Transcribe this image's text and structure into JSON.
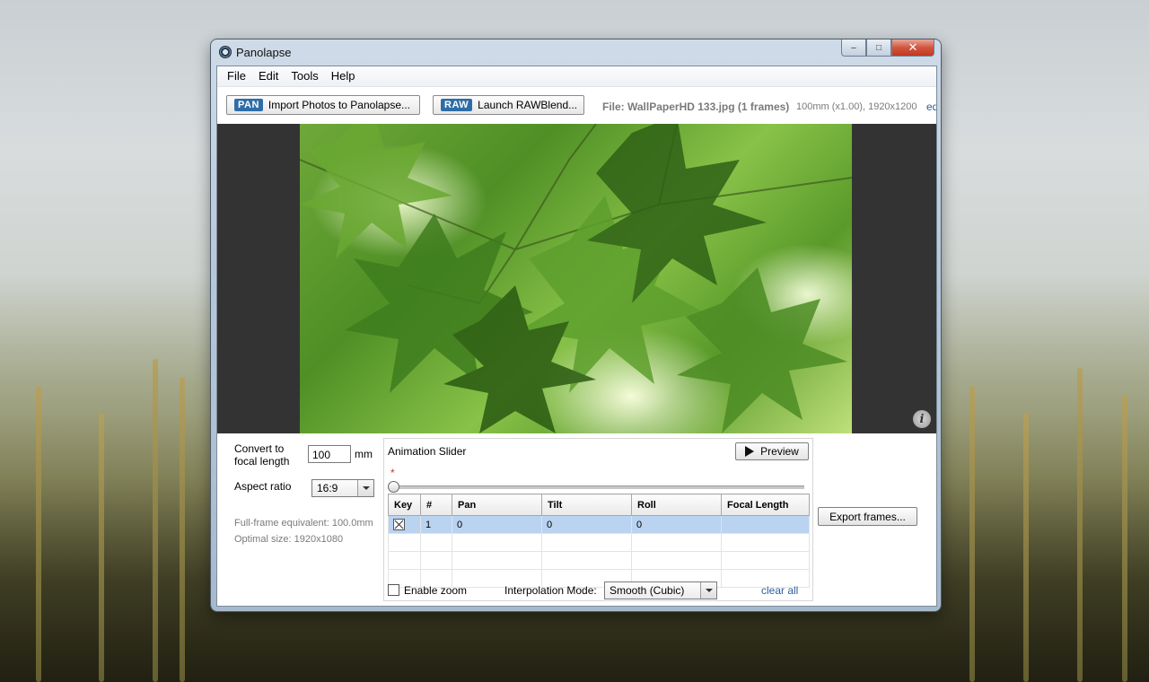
{
  "window": {
    "title": "Panolapse",
    "controls": {
      "minimize": "–",
      "maximize": "□",
      "close": "✕"
    }
  },
  "menu": [
    "File",
    "Edit",
    "Tools",
    "Help"
  ],
  "toolbar": {
    "import_badge": "PAN",
    "import_label": "Import Photos to Panolapse...",
    "raw_badge": "RAW",
    "raw_label": "Launch RAWBlend...",
    "file_info": "File: WallPaperHD 133.jpg (1 frames)",
    "file_details": "100mm (x1.00), 1920x1200",
    "cut_off": "ed"
  },
  "viewer": {
    "info_icon": "i"
  },
  "settings": {
    "convert_label_1": "Convert to",
    "convert_label_2": "focal length",
    "focal_value": "100",
    "focal_unit": "mm",
    "aspect_label": "Aspect ratio",
    "aspect_value": "16:9",
    "fullframe": "Full-frame equivalent: 100.0mm",
    "optimal": "Optimal size: 1920x1080"
  },
  "animation": {
    "title": "Animation Slider",
    "preview_label": "Preview",
    "keyframe_marker": "*",
    "columns": [
      "Key",
      "#",
      "Pan",
      "Tilt",
      "Roll",
      "Focal Length"
    ],
    "rows": [
      {
        "key": true,
        "num": "1",
        "pan": "0",
        "tilt": "0",
        "roll": "0",
        "focal": ""
      }
    ],
    "enable_zoom_label": "Enable zoom",
    "interp_label": "Interpolation Mode:",
    "interp_value": "Smooth (Cubic)",
    "clear_all": "clear all"
  },
  "export_label": "Export frames..."
}
